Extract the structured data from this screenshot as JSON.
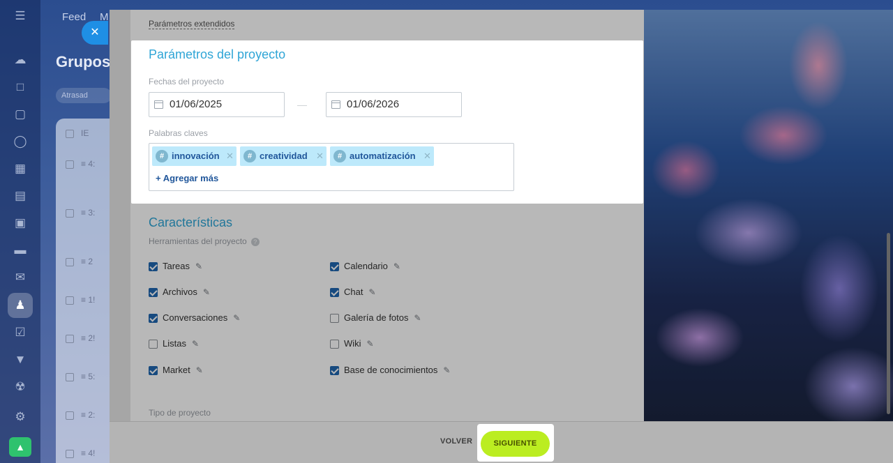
{
  "background": {
    "header_feed": "Feed",
    "header_more": "M",
    "title": "Grupos",
    "filter_pill": "Atrasad",
    "table_rows": [
      "4:",
      "3:",
      "2",
      "1!",
      "2!",
      "5:",
      "2:",
      "4!"
    ],
    "table_header": "IE"
  },
  "close_icon": "close-icon",
  "extended_params_link": "Parámetros extendidos",
  "project_params": {
    "title": "Parámetros del proyecto",
    "dates_label": "Fechas del proyecto",
    "start_date": "01/06/2025",
    "end_date": "01/06/2026",
    "keywords_label": "Palabras claves",
    "tags": [
      "innovación",
      "creatividad",
      "automatización"
    ],
    "add_more": "+ Agregar más"
  },
  "features": {
    "title": "Características",
    "tools_label": "Herramientas del proyecto",
    "help_glyph": "?",
    "tools": [
      {
        "label": "Tareas",
        "checked": true
      },
      {
        "label": "Calendario",
        "checked": true
      },
      {
        "label": "Archivos",
        "checked": true
      },
      {
        "label": "Chat",
        "checked": true
      },
      {
        "label": "Conversaciones",
        "checked": true
      },
      {
        "label": "Galería de fotos",
        "checked": false
      },
      {
        "label": "Listas",
        "checked": false
      },
      {
        "label": "Wiki",
        "checked": false
      },
      {
        "label": "Market",
        "checked": true
      },
      {
        "label": "Base de conocimientos",
        "checked": true
      }
    ],
    "project_type_label": "Tipo de proyecto"
  },
  "footer": {
    "back_label": "VOLVER",
    "next_label": "SIGUIENTE"
  },
  "colors": {
    "accent": "#2fa5d6",
    "checkbox": "#2067b0",
    "next_button": "#bbed21",
    "tag_bg": "#bde9fb"
  }
}
